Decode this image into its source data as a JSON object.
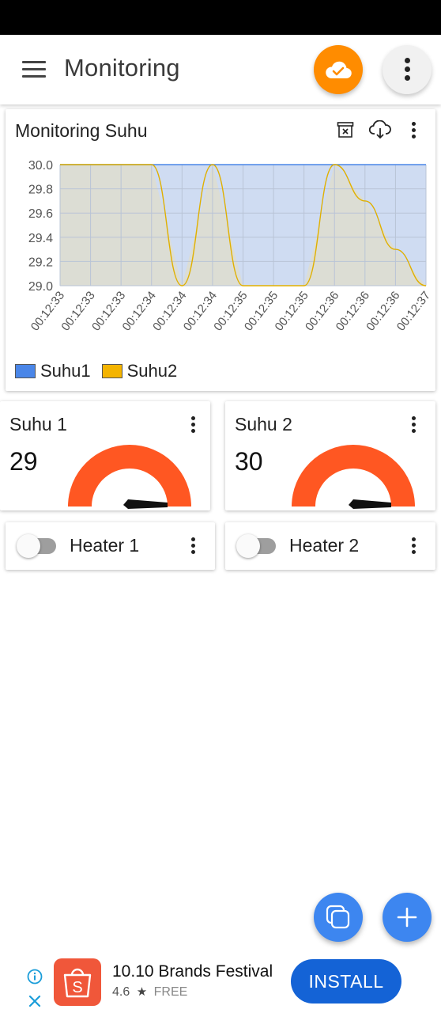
{
  "app": {
    "title": "Monitoring",
    "brand_color": "#ff8c00",
    "icons": {
      "menu": "hamburger-menu-icon",
      "cloud": "cloud-check-icon",
      "more": "more-vertical-icon"
    }
  },
  "chart_card": {
    "title": "Monitoring Suhu",
    "icons": [
      "archive-delete-icon",
      "cloud-download-icon",
      "more-vertical-icon"
    ]
  },
  "chart_data": {
    "type": "area",
    "title": "Monitoring Suhu",
    "ylim": [
      29.0,
      30.0
    ],
    "yticks": [
      "30.0",
      "29.8",
      "29.6",
      "29.4",
      "29.2",
      "29.0"
    ],
    "x": [
      "00:12:33",
      "00:12:33",
      "00:12:33",
      "00:12:34",
      "00:12:34",
      "00:12:34",
      "00:12:35",
      "00:12:35",
      "00:12:35",
      "00:12:36",
      "00:12:36",
      "00:12:36",
      "00:12:37"
    ],
    "grid": true,
    "legend_position": "bottom-left",
    "series": [
      {
        "name": "Suhu1",
        "color": "#4a86e8",
        "fill": "#cfdcf2",
        "values": [
          30.0,
          30.0,
          30.0,
          30.0,
          30.0,
          30.0,
          30.0,
          30.0,
          30.0,
          30.0,
          30.0,
          30.0,
          30.0
        ]
      },
      {
        "name": "Suhu2",
        "color": "#e0b000",
        "fill": "#dcdcd2",
        "values": [
          30.0,
          30.0,
          30.0,
          30.0,
          29.0,
          30.0,
          29.0,
          29.0,
          29.0,
          30.0,
          29.7,
          29.3,
          29.0
        ]
      }
    ]
  },
  "gauges": [
    {
      "title": "Suhu 1",
      "value": "29",
      "color": "#ff5722"
    },
    {
      "title": "Suhu 2",
      "value": "30",
      "color": "#ff5722"
    }
  ],
  "switches": [
    {
      "label": "Heater 1",
      "state": "off"
    },
    {
      "label": "Heater 2",
      "state": "off"
    }
  ],
  "fabs": {
    "left_icon": "copy-icon",
    "right_icon": "plus-icon"
  },
  "ad": {
    "title": "10.10 Brands Festival",
    "rating": "4.6",
    "price": "FREE",
    "button": "INSTALL",
    "logo_letter": "S"
  }
}
